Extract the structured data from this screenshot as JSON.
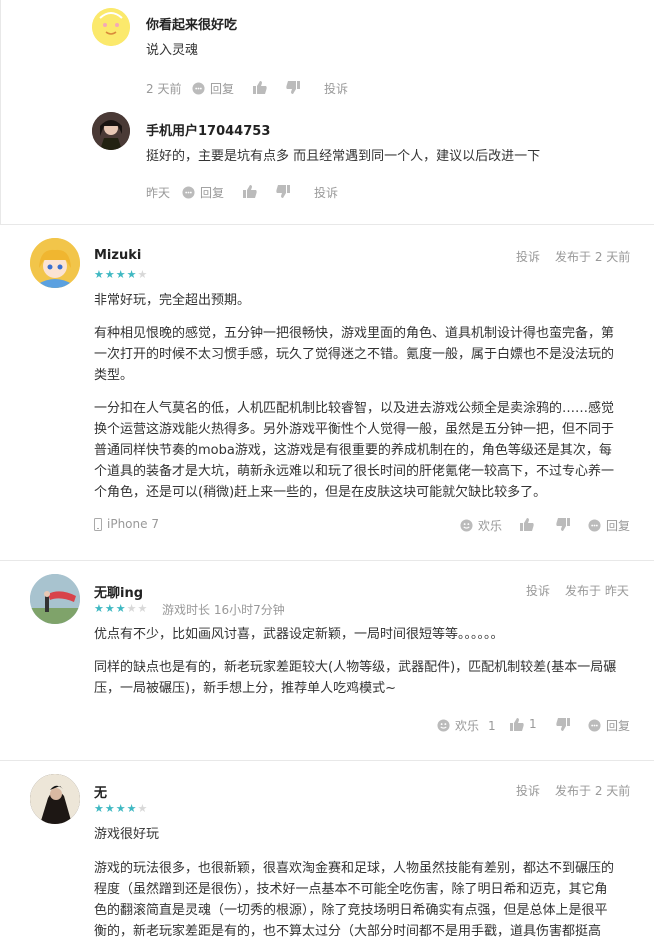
{
  "replies": [
    {
      "user": "你看起来很好吃",
      "text": "说入灵魂",
      "time": "2 天前",
      "reply_label": "回复",
      "report_label": "投诉"
    },
    {
      "user": "手机用户17044753",
      "text": "挺好的，主要是坑有点多 而且经常遇到同一个人，建议以后改进一下",
      "time": "昨天",
      "reply_label": "回复",
      "report_label": "投诉"
    }
  ],
  "reviews": [
    {
      "user": "Mizuki",
      "rating": 4,
      "report_label": "投诉",
      "posted": "发布于 2 天前",
      "paragraphs": [
        [
          "非常好玩，完全超出预期。"
        ],
        [
          "有种相见恨晚的感觉，五分钟一把很畅快，游戏里面的角色、道具机制设计得也蛮完备，第",
          "一次打开的时候不太习惯手感，玩久了觉得迷之不错。氪度一般，属于白嫖也不是没法玩的",
          "类型。"
        ],
        [
          "一分扣在人气莫名的低，人机匹配机制比较睿智，以及进去游戏公频全是卖涂鸦的……感觉",
          "换个运营这游戏能火热得多。另外游戏平衡性个人觉得一般，虽然是五分钟一把，但不同于",
          "普通同样快节奏的moba游戏，这游戏是有很重要的养成机制在的，角色等级还是其次，每",
          "个道具的装备才是大坑，萌新永远难以和玩了很长时间的肝佬氪佬一较高下，不过专心养一",
          "个角色，还是可以(稍微)赶上来一些的，但是在皮肤这块可能就欠缺比较多了。"
        ]
      ],
      "device": "iPhone 7",
      "funny_label": "欢乐",
      "reply_label": "回复"
    },
    {
      "user": "无聊ing",
      "rating": 3,
      "playtime": "游戏时长 16小时7分钟",
      "report_label": "投诉",
      "posted": "发布于 昨天",
      "paragraphs": [
        [
          "优点有不少，比如画风讨喜，武器设定新颖，一局时间很短等等。。。。。。"
        ],
        [
          "同样的缺点也是有的，新老玩家差距较大(人物等级，武器配件)，匹配机制较差(基本一局碾",
          "压，一局被碾压)，新手想上分，推荐单人吃鸡模式~"
        ]
      ],
      "funny_label": "欢乐",
      "funny_count": "1",
      "like_count": "1",
      "reply_label": "回复"
    },
    {
      "user": "无",
      "rating": 4,
      "report_label": "投诉",
      "posted": "发布于 2 天前",
      "paragraphs": [
        [
          "游戏很好玩"
        ],
        [
          "游戏的玩法很多，也很新颖，很喜欢淘金赛和足球，人物虽然技能有差别，都达不到碾压的",
          "程度（虽然蹭到还是很伤），技术好一点基本不可能全吃伤害，除了明日希和迈克，其它角",
          "色的翻滚简直是灵魂（一切秀的根源），除了竞技场明日希确实有点强，但是总体上是很平",
          "衡的，新老玩家差距是有的，也不算太过分（大部分时间都不是用手戳，道具伤害都挺高"
        ]
      ]
    }
  ],
  "icons": {
    "comment": "comment-icon",
    "like": "thumb-up-icon",
    "dislike": "thumb-down-icon",
    "funny": "smile-icon",
    "phone": "phone-icon"
  },
  "colors": {
    "star": "#3fb8c2",
    "star_empty": "#d8d8d8",
    "meta": "#999999"
  }
}
